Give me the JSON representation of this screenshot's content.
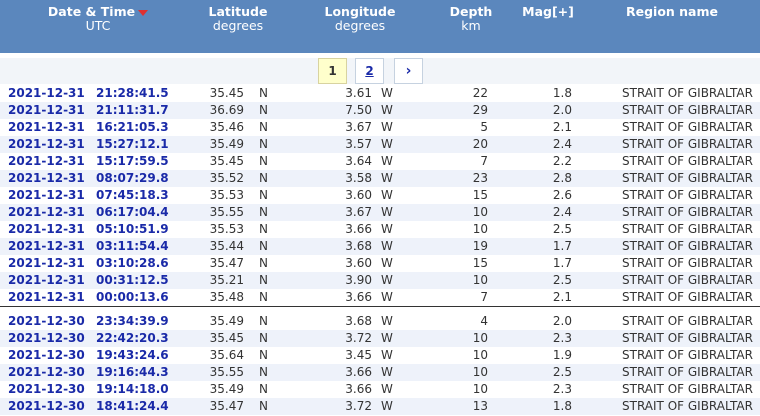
{
  "header": {
    "date_time_title": "Date & Time",
    "date_time_sub": "UTC",
    "lat_title": "Latitude",
    "lat_sub": "degrees",
    "lon_title": "Longitude",
    "lon_sub": "degrees",
    "depth_title": "Depth",
    "depth_sub": "km",
    "mag_title": "Mag[+]",
    "region_title": "Region name"
  },
  "pager": {
    "page1": "1",
    "page2": "2",
    "next": "›"
  },
  "rows_group1": [
    {
      "date": "2021-12-31",
      "time": "21:28:41.5",
      "lat": "35.45",
      "ns": "N",
      "lon": "3.61",
      "ew": "W",
      "depth": "22",
      "mag": "1.8",
      "region": "STRAIT OF GIBRALTAR"
    },
    {
      "date": "2021-12-31",
      "time": "21:11:31.7",
      "lat": "36.69",
      "ns": "N",
      "lon": "7.50",
      "ew": "W",
      "depth": "29",
      "mag": "2.0",
      "region": "STRAIT OF GIBRALTAR"
    },
    {
      "date": "2021-12-31",
      "time": "16:21:05.3",
      "lat": "35.46",
      "ns": "N",
      "lon": "3.67",
      "ew": "W",
      "depth": "5",
      "mag": "2.1",
      "region": "STRAIT OF GIBRALTAR"
    },
    {
      "date": "2021-12-31",
      "time": "15:27:12.1",
      "lat": "35.49",
      "ns": "N",
      "lon": "3.57",
      "ew": "W",
      "depth": "20",
      "mag": "2.4",
      "region": "STRAIT OF GIBRALTAR"
    },
    {
      "date": "2021-12-31",
      "time": "15:17:59.5",
      "lat": "35.45",
      "ns": "N",
      "lon": "3.64",
      "ew": "W",
      "depth": "7",
      "mag": "2.2",
      "region": "STRAIT OF GIBRALTAR"
    },
    {
      "date": "2021-12-31",
      "time": "08:07:29.8",
      "lat": "35.52",
      "ns": "N",
      "lon": "3.58",
      "ew": "W",
      "depth": "23",
      "mag": "2.8",
      "region": "STRAIT OF GIBRALTAR"
    },
    {
      "date": "2021-12-31",
      "time": "07:45:18.3",
      "lat": "35.53",
      "ns": "N",
      "lon": "3.60",
      "ew": "W",
      "depth": "15",
      "mag": "2.6",
      "region": "STRAIT OF GIBRALTAR"
    },
    {
      "date": "2021-12-31",
      "time": "06:17:04.4",
      "lat": "35.55",
      "ns": "N",
      "lon": "3.67",
      "ew": "W",
      "depth": "10",
      "mag": "2.4",
      "region": "STRAIT OF GIBRALTAR"
    },
    {
      "date": "2021-12-31",
      "time": "05:10:51.9",
      "lat": "35.53",
      "ns": "N",
      "lon": "3.66",
      "ew": "W",
      "depth": "10",
      "mag": "2.5",
      "region": "STRAIT OF GIBRALTAR"
    },
    {
      "date": "2021-12-31",
      "time": "03:11:54.4",
      "lat": "35.44",
      "ns": "N",
      "lon": "3.68",
      "ew": "W",
      "depth": "19",
      "mag": "1.7",
      "region": "STRAIT OF GIBRALTAR"
    },
    {
      "date": "2021-12-31",
      "time": "03:10:28.6",
      "lat": "35.47",
      "ns": "N",
      "lon": "3.60",
      "ew": "W",
      "depth": "15",
      "mag": "1.7",
      "region": "STRAIT OF GIBRALTAR"
    },
    {
      "date": "2021-12-31",
      "time": "00:31:12.5",
      "lat": "35.21",
      "ns": "N",
      "lon": "3.90",
      "ew": "W",
      "depth": "10",
      "mag": "2.5",
      "region": "STRAIT OF GIBRALTAR"
    },
    {
      "date": "2021-12-31",
      "time": "00:00:13.6",
      "lat": "35.48",
      "ns": "N",
      "lon": "3.66",
      "ew": "W",
      "depth": "7",
      "mag": "2.1",
      "region": "STRAIT OF GIBRALTAR"
    }
  ],
  "rows_group2": [
    {
      "date": "2021-12-30",
      "time": "23:34:39.9",
      "lat": "35.49",
      "ns": "N",
      "lon": "3.68",
      "ew": "W",
      "depth": "4",
      "mag": "2.0",
      "region": "STRAIT OF GIBRALTAR"
    },
    {
      "date": "2021-12-30",
      "time": "22:42:20.3",
      "lat": "35.45",
      "ns": "N",
      "lon": "3.72",
      "ew": "W",
      "depth": "10",
      "mag": "2.3",
      "region": "STRAIT OF GIBRALTAR"
    },
    {
      "date": "2021-12-30",
      "time": "19:43:24.6",
      "lat": "35.64",
      "ns": "N",
      "lon": "3.45",
      "ew": "W",
      "depth": "10",
      "mag": "1.9",
      "region": "STRAIT OF GIBRALTAR"
    },
    {
      "date": "2021-12-30",
      "time": "19:16:44.3",
      "lat": "35.55",
      "ns": "N",
      "lon": "3.66",
      "ew": "W",
      "depth": "10",
      "mag": "2.5",
      "region": "STRAIT OF GIBRALTAR"
    },
    {
      "date": "2021-12-30",
      "time": "19:14:18.0",
      "lat": "35.49",
      "ns": "N",
      "lon": "3.66",
      "ew": "W",
      "depth": "10",
      "mag": "2.3",
      "region": "STRAIT OF GIBRALTAR"
    },
    {
      "date": "2021-12-30",
      "time": "18:41:24.4",
      "lat": "35.47",
      "ns": "N",
      "lon": "3.72",
      "ew": "W",
      "depth": "13",
      "mag": "1.8",
      "region": "STRAIT OF GIBRALTAR"
    }
  ]
}
